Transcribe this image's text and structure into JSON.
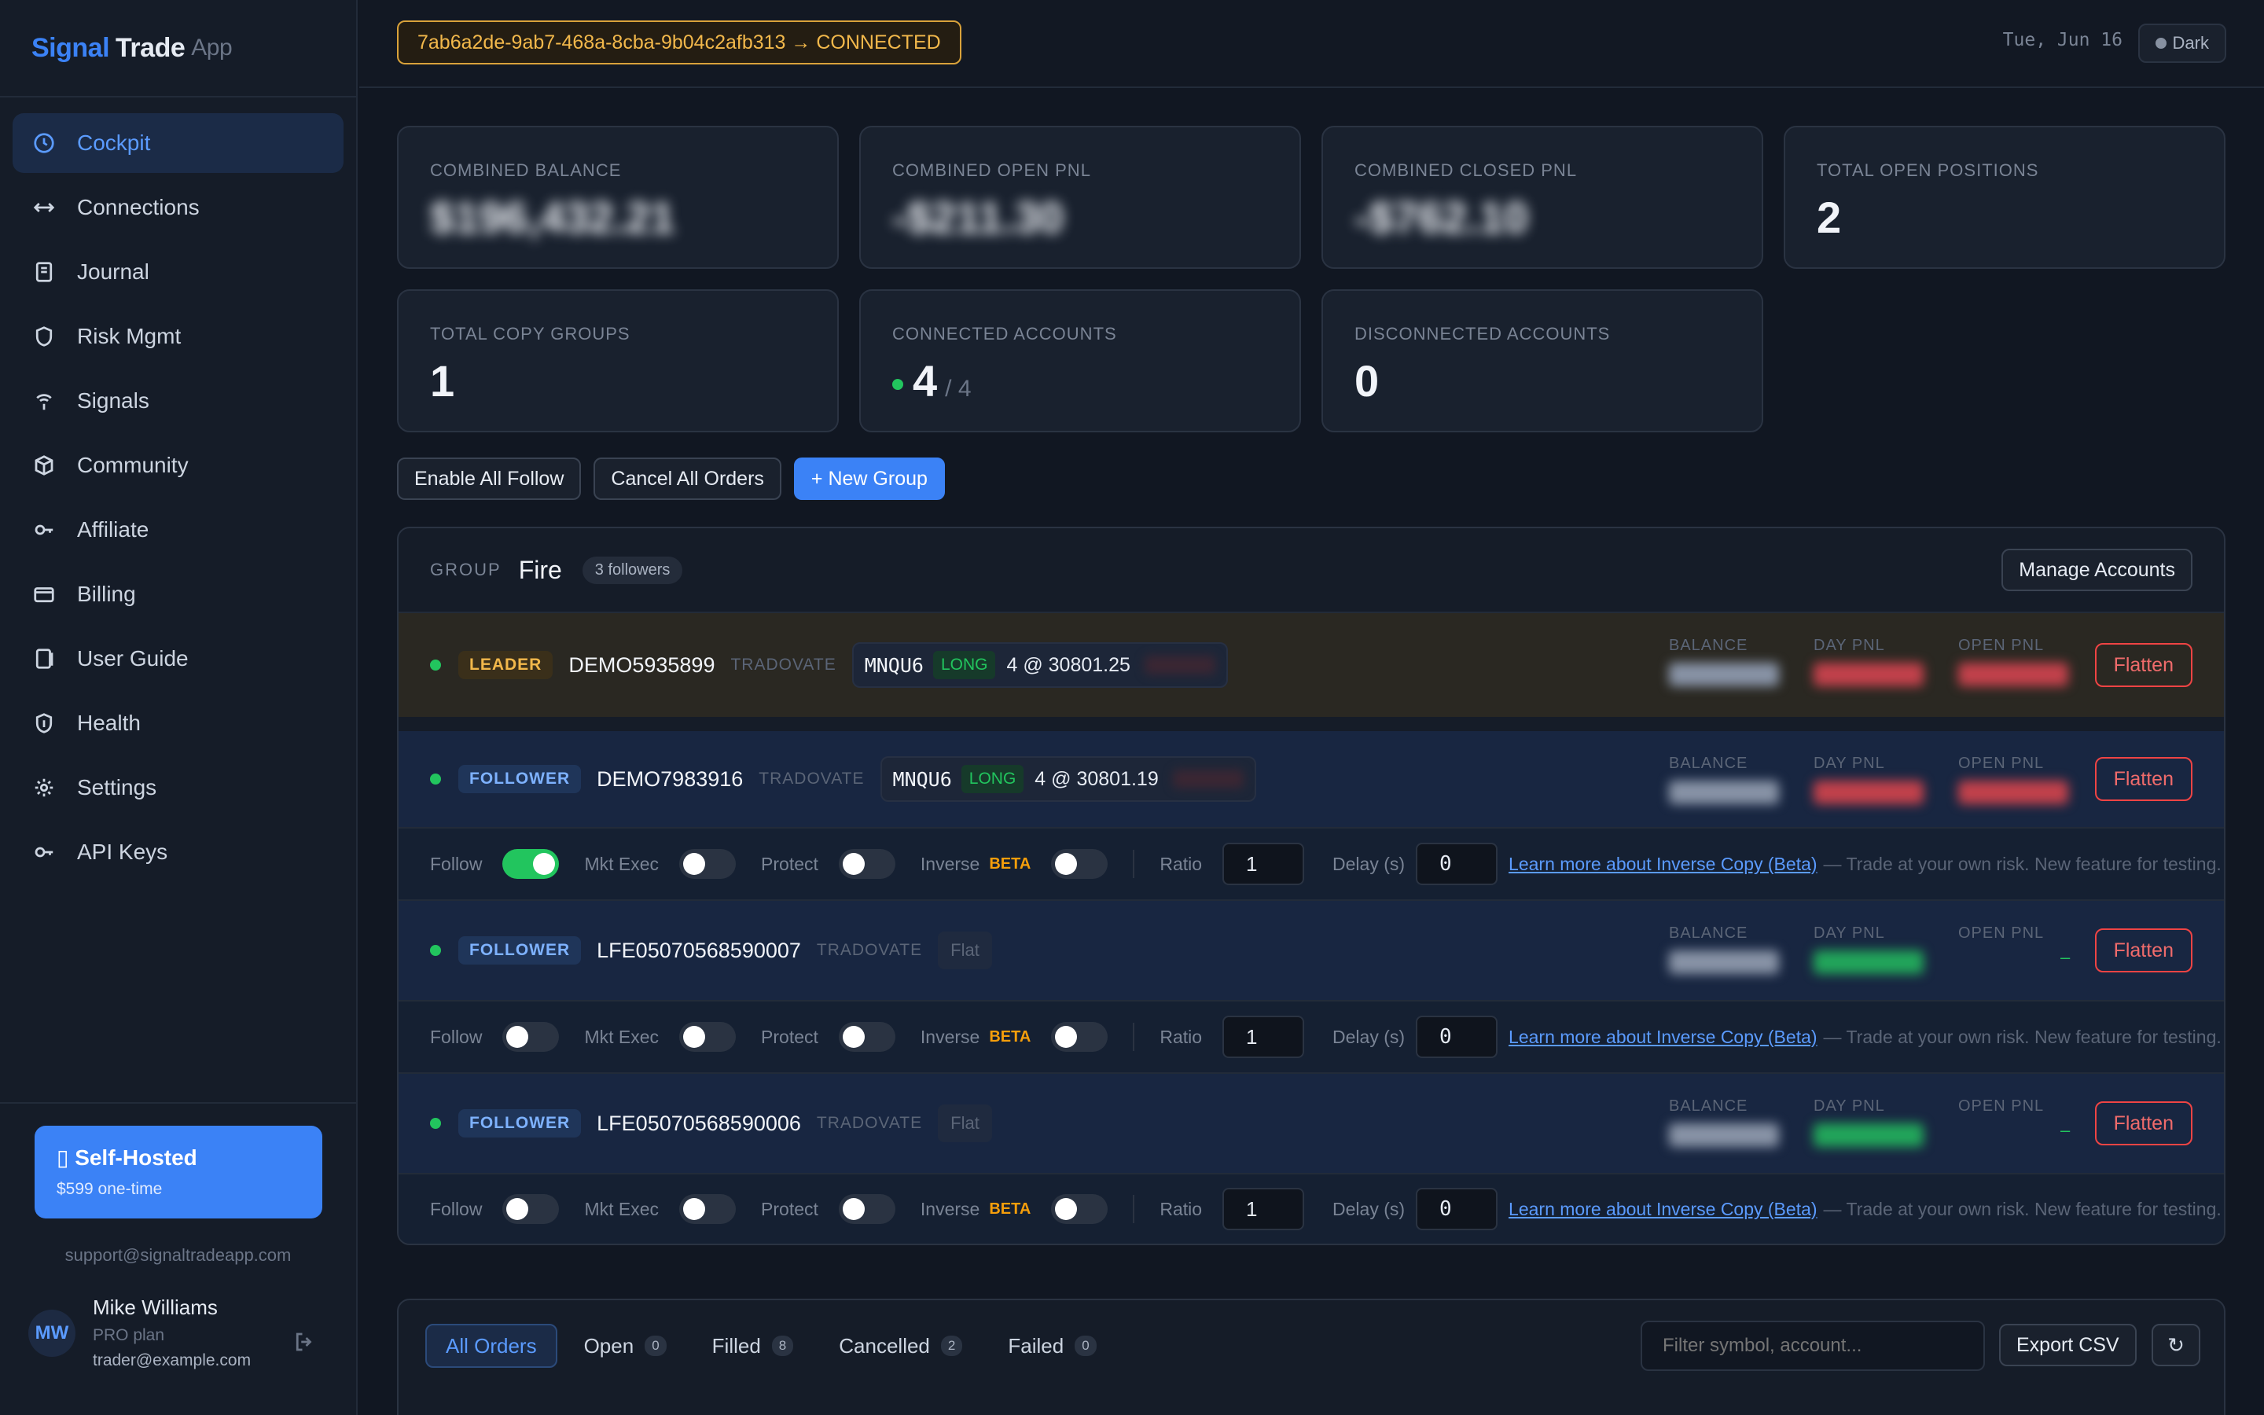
{
  "brand": {
    "part1": "Signal",
    "part2": "Trade",
    "part3": "App"
  },
  "nav": [
    {
      "label": "Cockpit",
      "icon": "clock-icon",
      "active": true
    },
    {
      "label": "Connections",
      "icon": "arrows-horizontal-icon"
    },
    {
      "label": "Journal",
      "icon": "journal-icon"
    },
    {
      "label": "Risk Mgmt",
      "icon": "shield-icon"
    },
    {
      "label": "Signals",
      "icon": "signal-icon"
    },
    {
      "label": "Community",
      "icon": "cube-icon"
    },
    {
      "label": "Affiliate",
      "icon": "key-icon"
    },
    {
      "label": "Billing",
      "icon": "credit-card-icon"
    },
    {
      "label": "User Guide",
      "icon": "book-icon"
    },
    {
      "label": "Health",
      "icon": "heart-shield-icon"
    },
    {
      "label": "Settings",
      "icon": "gear-icon"
    },
    {
      "label": "API Keys",
      "icon": "key-icon"
    }
  ],
  "selfhosted": {
    "title": "▯ Self-Hosted",
    "price": "$599 one-time"
  },
  "support_email": "support@signaltradeapp.com",
  "user": {
    "initials": "MW",
    "name": "Mike Williams",
    "plan": "PRO plan",
    "email": "trader@example.com"
  },
  "topbar": {
    "connection": "7ab6a2de-9ab7-468a-8cba-9b04c2afb313 → CONNECTED",
    "date": "Tue, Jun 16",
    "theme": "Dark"
  },
  "stats": [
    {
      "label": "COMBINED BALANCE",
      "value": "$196,432.21",
      "hidden": true,
      "tone": "white"
    },
    {
      "label": "COMBINED OPEN PNL",
      "value": "-$211.30",
      "hidden": true,
      "tone": "red"
    },
    {
      "label": "COMBINED CLOSED PNL",
      "value": "-$762.10",
      "hidden": true,
      "tone": "red"
    },
    {
      "label": "TOTAL OPEN POSITIONS",
      "value": "2",
      "tone": "white"
    },
    {
      "label": "TOTAL COPY GROUPS",
      "value": "1",
      "tone": "white"
    },
    {
      "label": "CONNECTED ACCOUNTS",
      "value": "4",
      "sub": "/ 4",
      "tone": "white"
    },
    {
      "label": "DISCONNECTED ACCOUNTS",
      "value": "0",
      "tone": "green"
    }
  ],
  "actions": {
    "enable_follow": "Enable All Follow",
    "cancel_orders": "Cancel All Orders",
    "new_group": "+ New Group"
  },
  "group": {
    "label": "GROUP",
    "name": "Fire",
    "followers": "3 followers",
    "manage": "Manage Accounts",
    "metric_labels": {
      "balance": "BALANCE",
      "day_pnl": "DAY PNL",
      "open_pnl": "OPEN PNL"
    },
    "flatten": "Flatten",
    "controls": {
      "follow": "Follow",
      "mkt_exec": "Mkt Exec",
      "protect": "Protect",
      "inverse": "Inverse",
      "beta": "BETA",
      "ratio": "Ratio",
      "delay": "Delay (s)",
      "learn": "Learn more about Inverse Copy (Beta)",
      "note": "— Trade at your own risk. New feature for testing."
    },
    "accounts": [
      {
        "role": "LEADER",
        "id": "DEMO5935899",
        "broker": "TRADOVATE",
        "position": {
          "symbol": "MNQU6",
          "side": "LONG",
          "qty": "4 @ 30801.25"
        }
      },
      {
        "role": "FOLLOWER",
        "id": "DEMO7983916",
        "broker": "TRADOVATE",
        "position": {
          "symbol": "MNQU6",
          "side": "LONG",
          "qty": "4 @ 30801.19"
        },
        "follow": true,
        "ratio": "1",
        "delay": "0"
      },
      {
        "role": "FOLLOWER",
        "id": "LFE05070568590007",
        "broker": "TRADOVATE",
        "flat": "Flat",
        "dash": "–",
        "follow": false,
        "ratio": "1",
        "delay": "0"
      },
      {
        "role": "FOLLOWER",
        "id": "LFE05070568590006",
        "broker": "TRADOVATE",
        "flat": "Flat",
        "dash": "–",
        "follow": false,
        "ratio": "1",
        "delay": "0"
      }
    ]
  },
  "orders": {
    "tabs": [
      {
        "label": "All Orders",
        "active": true
      },
      {
        "label": "Open",
        "count": "0"
      },
      {
        "label": "Filled",
        "count": "8"
      },
      {
        "label": "Cancelled",
        "count": "2"
      },
      {
        "label": "Failed",
        "count": "0"
      }
    ],
    "filter_placeholder": "Filter symbol, account...",
    "export": "Export CSV",
    "refresh": "↻"
  }
}
